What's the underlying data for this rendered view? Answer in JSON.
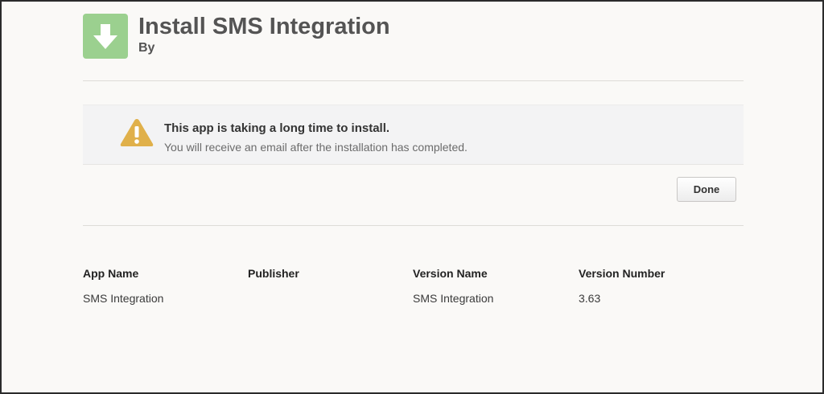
{
  "header": {
    "title": "Install SMS Integration",
    "publisher_line": "By",
    "icon": "download-arrow-icon",
    "icon_color": "#9bd08f"
  },
  "alert": {
    "icon": "warning-triangle-icon",
    "icon_color": "#e0b04a",
    "heading": "This app is taking a long time to install.",
    "message": "You will receive an email after the installation has completed."
  },
  "actions": {
    "done_label": "Done"
  },
  "details": {
    "columns": [
      {
        "header": "App Name",
        "value": "SMS Integration"
      },
      {
        "header": "Publisher",
        "value": ""
      },
      {
        "header": "Version Name",
        "value": "SMS Integration"
      },
      {
        "header": "Version Number",
        "value": "3.63"
      }
    ]
  }
}
